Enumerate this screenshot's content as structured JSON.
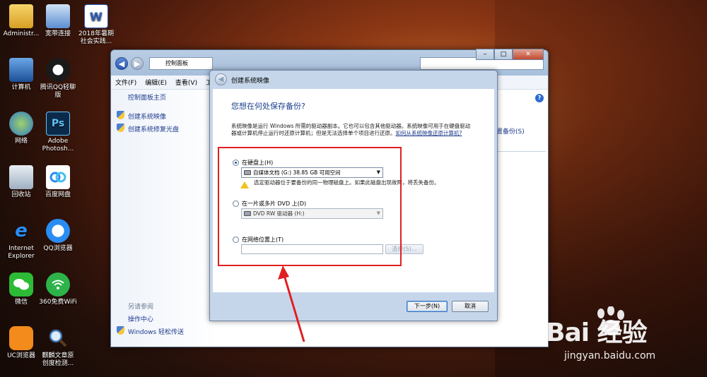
{
  "desktop": {
    "icons": [
      {
        "label": "Administr...",
        "name": "administrator-folder"
      },
      {
        "label": "宽带连接",
        "name": "broadband-connection"
      },
      {
        "label": "2018年暑期\n社会实践...",
        "name": "word-document"
      },
      {
        "label": "计算机",
        "name": "computer"
      },
      {
        "label": "腾讯QQ轻聊\n版",
        "name": "qq"
      },
      {
        "label": "网络",
        "name": "network"
      },
      {
        "label": "Adobe\nPhotosh...",
        "name": "photoshop"
      },
      {
        "label": "回收站",
        "name": "recycle-bin"
      },
      {
        "label": "百度网盘",
        "name": "baidu-netdisk"
      },
      {
        "label": "Internet\nExplorer",
        "name": "internet-explorer"
      },
      {
        "label": "QQ浏览器",
        "name": "qq-browser"
      },
      {
        "label": "微信",
        "name": "wechat"
      },
      {
        "label": "360免费WiFi",
        "name": "360-wifi"
      },
      {
        "label": "UC浏览器",
        "name": "uc-browser"
      },
      {
        "label": "麒麟文章原\n创度检测...",
        "name": "article-checker"
      }
    ]
  },
  "control_panel": {
    "address": "控制面板",
    "menu": [
      "文件(F)",
      "编辑(E)",
      "查看(V)",
      "工"
    ],
    "sidebar": {
      "home": "控制面板主页",
      "links": [
        "创建系统映像",
        "创建系统修复光盘"
      ],
      "see_also": "另请参阅",
      "see_also_links": [
        "操作中心",
        "Windows 轻松传送"
      ]
    },
    "right_link": "置备份(S)",
    "help": "?"
  },
  "dialog": {
    "title": "创建系统映像",
    "heading": "您想在何处保存备份?",
    "description": "系统映像是运行 Windows 所需的驱动器副本。它也可以包含其他驱动器。系统映像可用于在硬盘驱动器或计算机停止运行时还原计算机；但是无法选择单个项目进行还原。",
    "description_link": "如何从系统映像还原计算机?",
    "options": {
      "hard_disk": {
        "label": "在硬盘上(H)",
        "selected_value": "自媒体文档 (G:) 38.85 GB 可用空间",
        "warning": "选定驱动器位于要备份的同一物理磁盘上。如果此磁盘出现故障，将丢失备份。"
      },
      "dvd": {
        "label": "在一片或多片 DVD 上(D)",
        "selected_value": "DVD RW 驱动器 (H:)"
      },
      "network": {
        "label": "在网络位置上(T)",
        "value": "",
        "select_button": "选择(S)..."
      }
    },
    "buttons": {
      "next": "下一步(N)",
      "cancel": "取消"
    }
  },
  "watermark": {
    "main": "Bai 经验",
    "sub": "jingyan.baidu.com"
  },
  "colors": {
    "annotation_red": "#e02020",
    "heading_blue": "#1b3f8e",
    "link_blue": "#1e3a8c"
  }
}
